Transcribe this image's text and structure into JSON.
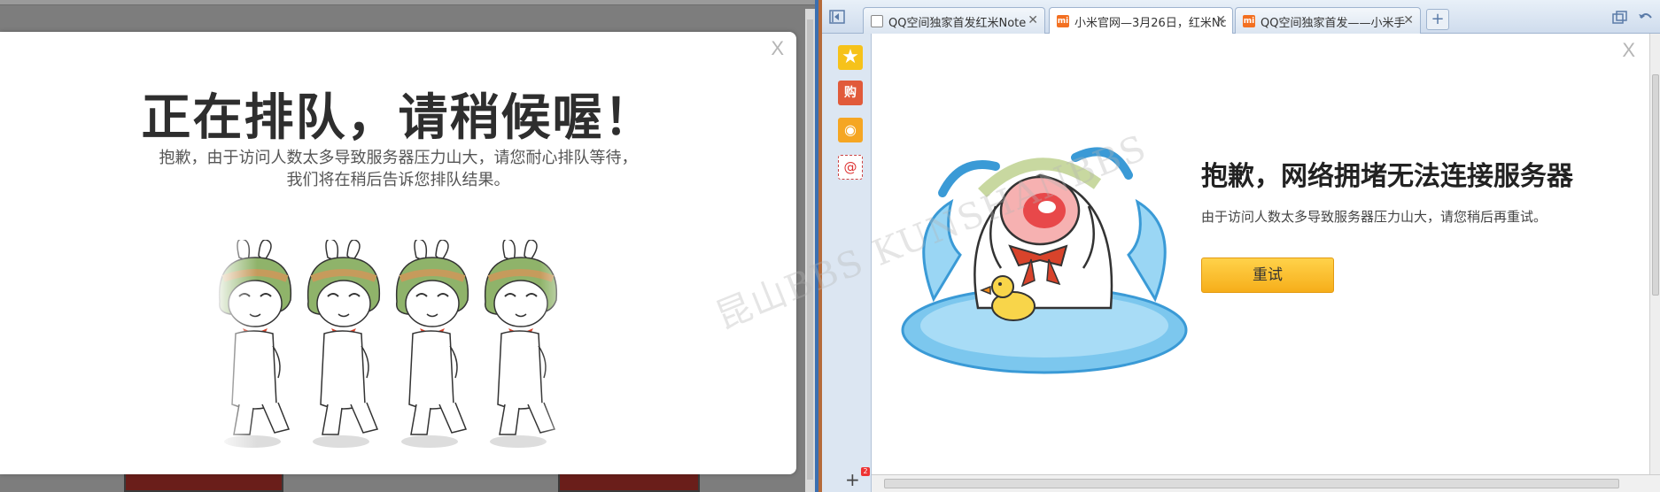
{
  "left_modal": {
    "close": "X",
    "title": "正在排队，请稍候喔！",
    "message_line1": "抱歉，由于访问人数太多导致服务器压力山大，请您耐心排队等待，",
    "message_line2": "我们将在稍后告诉您排队结果。"
  },
  "browser": {
    "tabs": [
      {
        "label": "QQ空间独家首发红米Note"
      },
      {
        "label": "小米官网—3月26日，红米Nc"
      },
      {
        "label": "QQ空间独家首发——小米手"
      }
    ],
    "favicon_mi": "mi",
    "new_tab": "+",
    "sidebar": {
      "gou": "购",
      "mail": "@",
      "add": "+",
      "badge": "2"
    }
  },
  "error_dialog": {
    "close": "X",
    "title": "抱歉，网络拥堵无法连接服务器",
    "message": "由于访问人数太多导致服务器压力山大，请您稍后再重试。",
    "retry_label": "重试"
  },
  "watermark": "昆山BBS KUNSHANBBS"
}
